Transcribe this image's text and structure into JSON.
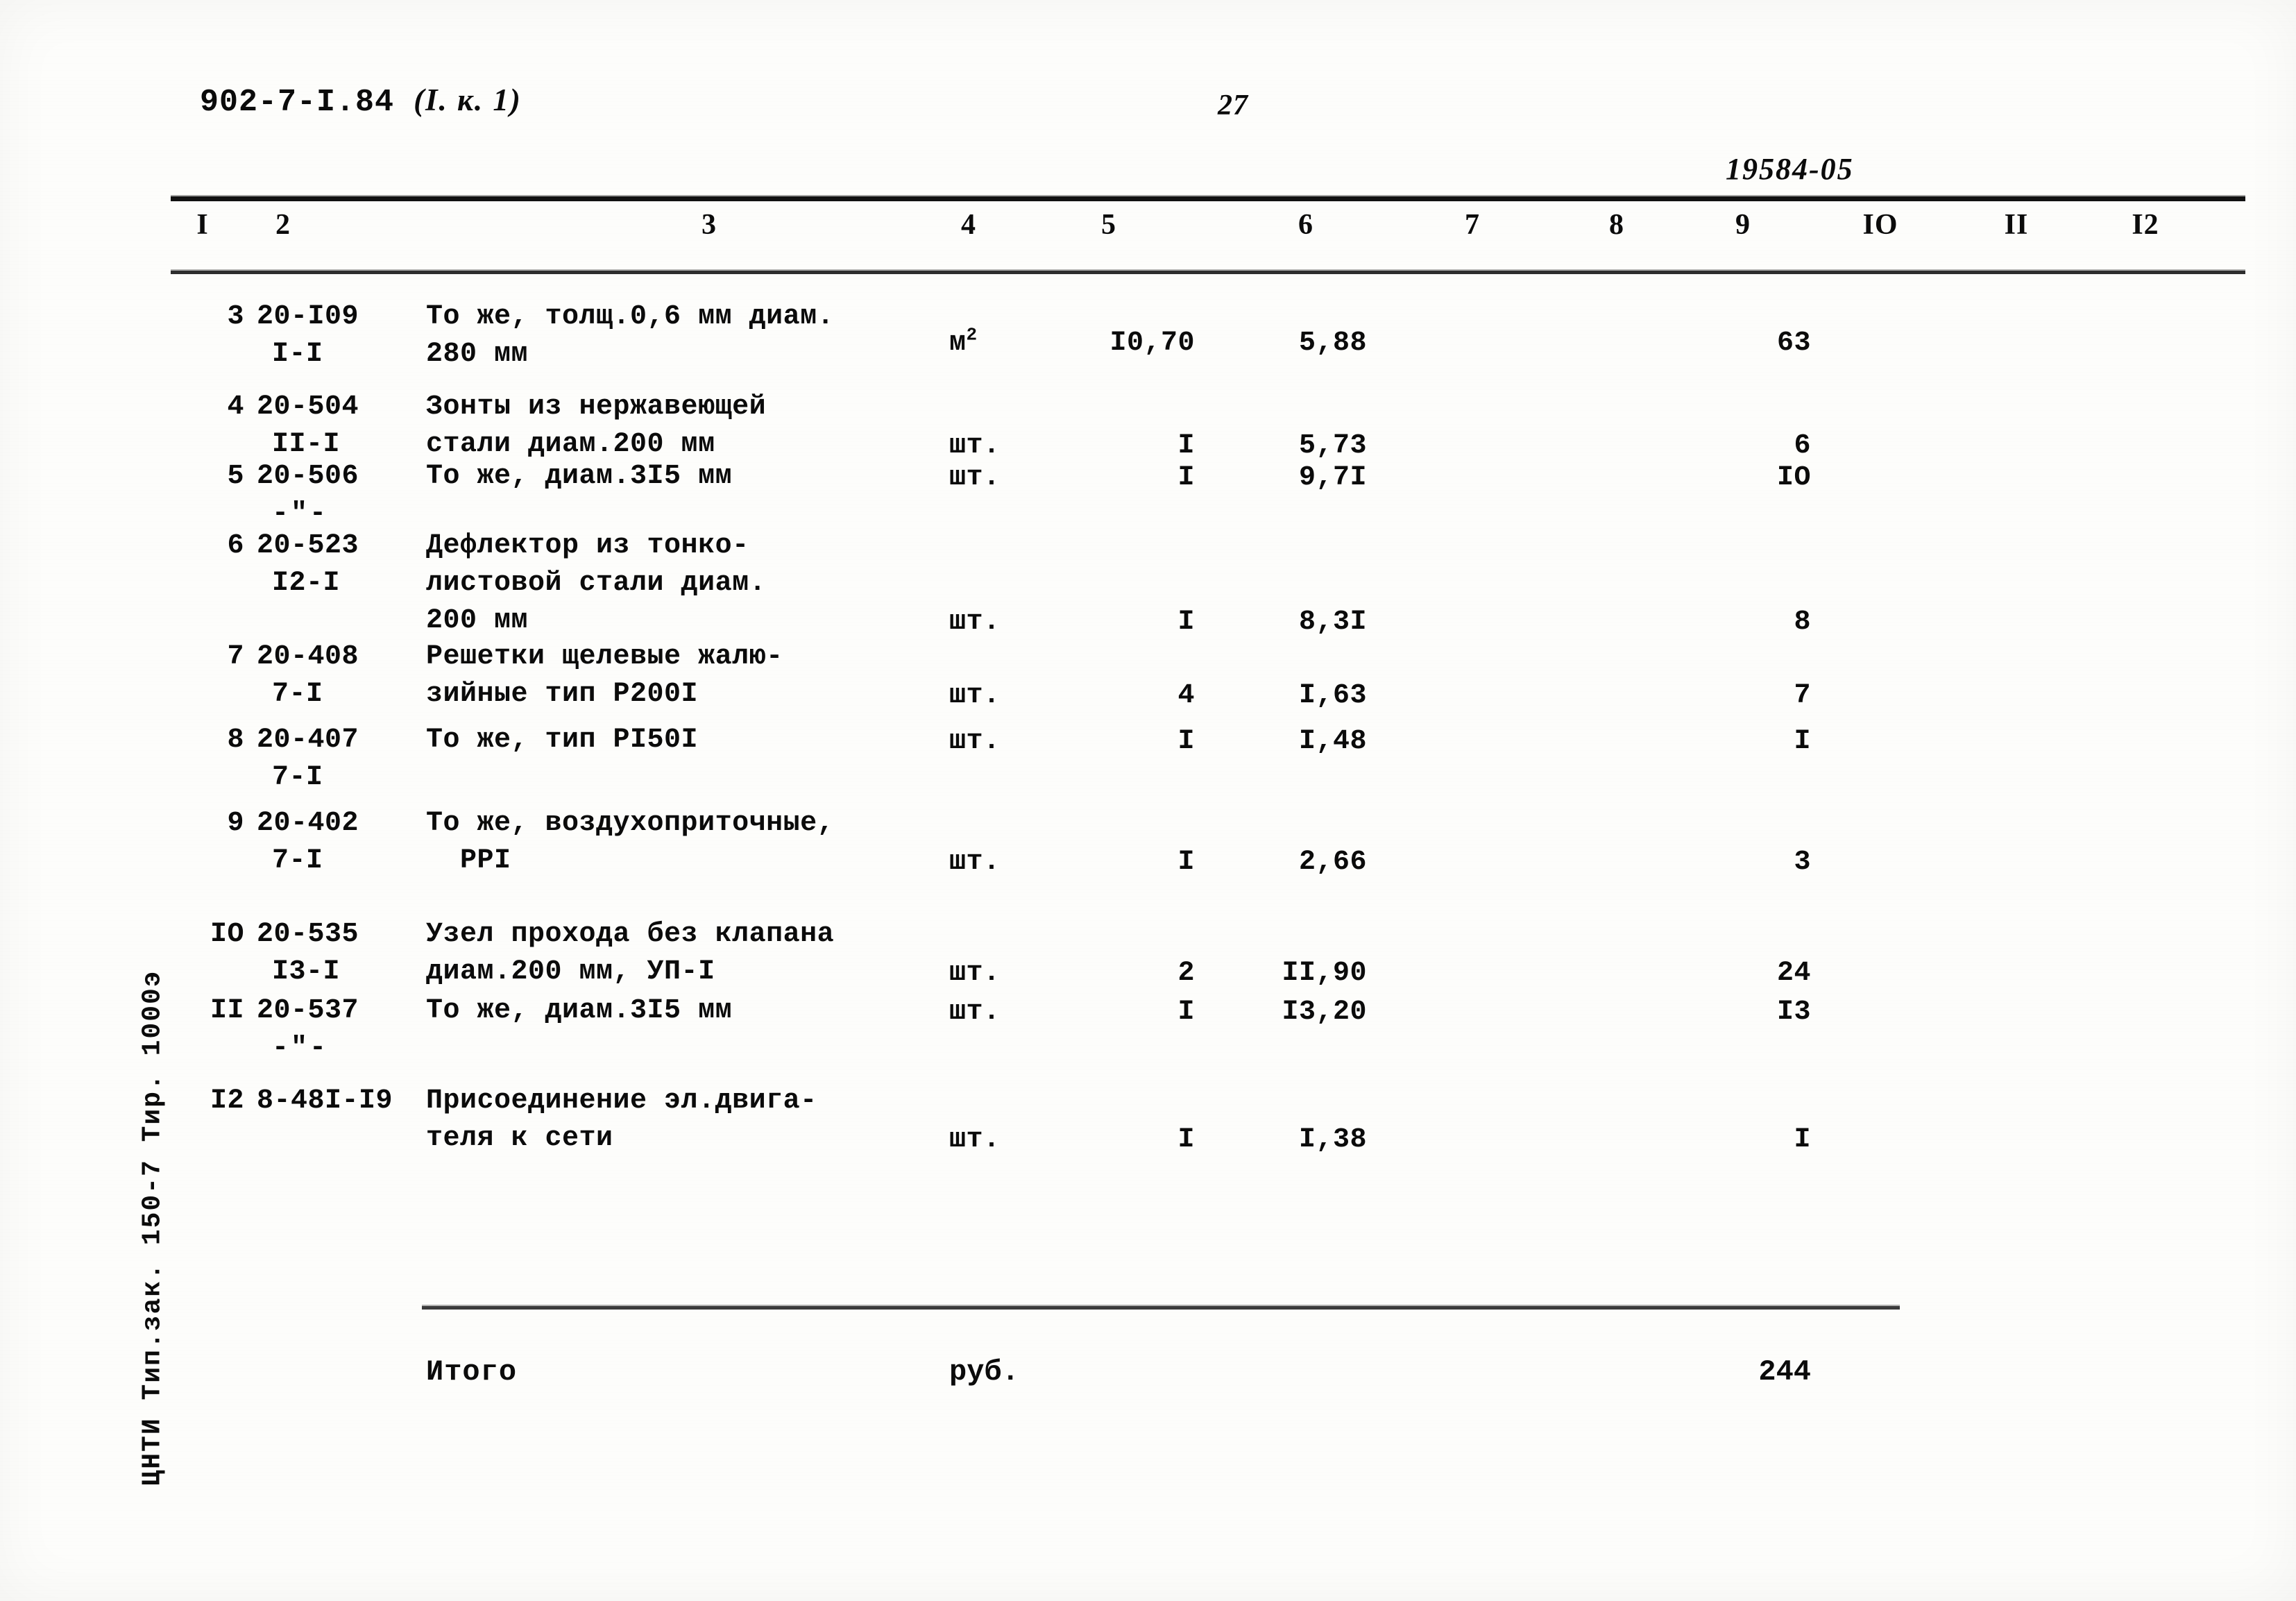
{
  "header": {
    "doc_code": "902-7-I.84",
    "doc_code_annotation": "(I. к. 1)",
    "page_number": "27",
    "sheet_code": "19584-05"
  },
  "table": {
    "column_headers": [
      "I",
      "2",
      "3",
      "4",
      "5",
      "6",
      "7",
      "8",
      "9",
      "IO",
      "II",
      "I2"
    ],
    "rows": [
      {
        "num": "3",
        "code": "20-I09",
        "code2": "I-I",
        "desc_line1": "То же, толщ.0,6 мм диам.",
        "desc_line2": "280 мм",
        "unit": "м",
        "unit_sup": "2",
        "qty": "I0,70",
        "price": "5,88",
        "total": "63"
      },
      {
        "num": "4",
        "code": "20-504",
        "code2": "II-I",
        "desc_line1": "Зонты из нержавеющей",
        "desc_line2": "стали диам.200 мм",
        "unit": "шт.",
        "unit_sup": "",
        "qty": "I",
        "price": "5,73",
        "total": "6"
      },
      {
        "num": "5",
        "code": "20-506",
        "code2": "-\"-",
        "desc_line1": "То же, диам.3I5 мм",
        "desc_line2": "",
        "unit": "шт.",
        "unit_sup": "",
        "qty": "I",
        "price": "9,7I",
        "total": "IO"
      },
      {
        "num": "6",
        "code": "20-523",
        "code2": "I2-I",
        "desc_line1": "Дефлектор из тонко-",
        "desc_line2": "листовой стали диам.",
        "desc_line3": "200 мм",
        "unit": "шт.",
        "unit_sup": "",
        "qty": "I",
        "price": "8,3I",
        "total": "8"
      },
      {
        "num": "7",
        "code": "20-408",
        "code2": "7-I",
        "desc_line1": "Решетки щелевые жалю-",
        "desc_line2": "зийные тип Р200I",
        "unit": "шт.",
        "unit_sup": "",
        "qty": "4",
        "price": "I,63",
        "total": "7"
      },
      {
        "num": "8",
        "code": "20-407",
        "code2": "7-I",
        "desc_line1": "То же, тип РI50I",
        "desc_line2": "",
        "unit": "шт.",
        "unit_sup": "",
        "qty": "I",
        "price": "I,48",
        "total": "I"
      },
      {
        "num": "9",
        "code": "20-402",
        "code2": "7-I",
        "desc_line1": "То же, воздухоприточные,",
        "desc_line2": "  РРI",
        "unit": "шт.",
        "unit_sup": "",
        "qty": "I",
        "price": "2,66",
        "total": "3"
      },
      {
        "num": "IO",
        "code": "20-535",
        "code2": "I3-I",
        "desc_line1": "Узел прохода без клапана",
        "desc_line2": "диам.200 мм, УП-I",
        "unit": "шт.",
        "unit_sup": "",
        "qty": "2",
        "price": "II,90",
        "total": "24"
      },
      {
        "num": "II",
        "code": "20-537",
        "code2": "-\"-",
        "desc_line1": "То же, диам.3I5 мм",
        "desc_line2": "",
        "unit": "шт.",
        "unit_sup": "",
        "qty": "I",
        "price": "I3,20",
        "total": "I3"
      },
      {
        "num": "I2",
        "code": "8-48I-I9",
        "code2": "",
        "desc_line1": "Присоединение эл.двига-",
        "desc_line2": "теля к сети",
        "unit": "шт.",
        "unit_sup": "",
        "qty": "I",
        "price": "I,38",
        "total": "I"
      }
    ],
    "summary": {
      "label": "Итого",
      "unit": "руб.",
      "value": "244"
    }
  },
  "imprint": "ЦНТИ Тип.зак. 150-7 Тир. 1000э"
}
